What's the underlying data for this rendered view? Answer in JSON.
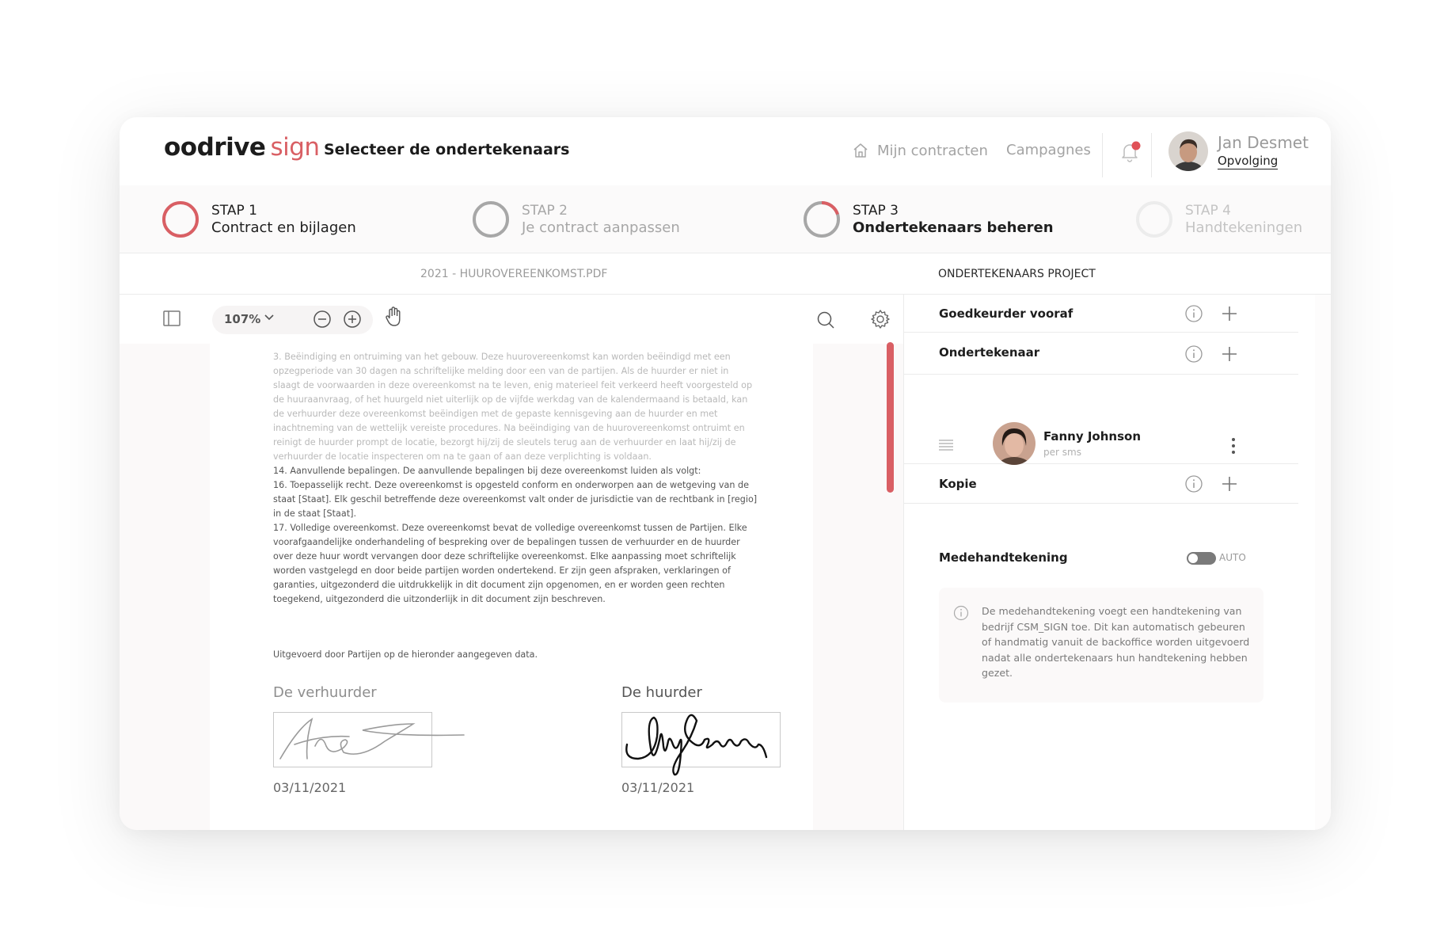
{
  "brand": {
    "name": "oodrive",
    "product": "sign",
    "accent": "#d95f64"
  },
  "header": {
    "page_title": "Selecteer de ondertekenaars",
    "nav": {
      "contracts": "Mijn contracten",
      "campaigns": "Campagnes"
    },
    "user": {
      "name": "Jan Desmet",
      "link": "Opvolging"
    },
    "icons": {
      "home": "home-icon",
      "bell": "bell-icon",
      "notification_dot": "#e05157"
    }
  },
  "steps": [
    {
      "num": "STAP 1",
      "label": "Contract en bijlagen",
      "progress": 1.0
    },
    {
      "num": "STAP 2",
      "label": "Je contract aanpassen",
      "progress": 0.0
    },
    {
      "num": "STAP 3",
      "label": "Ondertekenaars beheren",
      "progress": 0.2
    },
    {
      "num": "STAP 4",
      "label": "Handtekeningen",
      "progress": 0.0
    }
  ],
  "document": {
    "filename": "2021 - HUUROVEREENKOMST.PDF",
    "zoom": "107%",
    "paragraphs": [
      "3. Beëindiging en ontruiming van het gebouw.  Deze huurovereenkomst kan worden beëindigd met een opzegperiode van 30 dagen na schriftelijke melding door een van de partijen.  Als de huurder er niet in slaagt de voorwaarden in deze overeenkomst na te leven, enig materieel feit verkeerd heeft voorgesteld op de huuraanvraag, of het huurgeld niet uiterlijk op de vijfde werkdag van de kalendermaand is betaald, kan de verhuurder deze overeenkomst beëindigen met de gepaste kennisgeving aan de huurder en met inachtneming van de wettelijk vereiste procedures.  Na beëindiging van de huurovereenkomst ontruimt en reinigt de huurder prompt de locatie, bezorgt hij/zij de sleutels terug aan de verhuurder en laat hij/zij de verhuurder de locatie inspecteren om na te gaan of aan deze verplichting is voldaan.",
      "14. Aanvullende bepalingen.  De aanvullende bepalingen bij deze overeenkomst luiden als volgt:",
      "16. Toepasselijk recht.  Deze overeenkomst is opgesteld conform en onderworpen aan de wetgeving van de staat [Staat]. Elk geschil betreffende deze overeenkomst valt onder de jurisdictie van de rechtbank in [regio] in de staat [Staat].",
      "17. Volledige overeenkomst.  Deze overeenkomst bevat de volledige overeenkomst tussen de Partijen.  Elke voorafgaandelijke onderhandeling of bespreking over de bepalingen tussen de verhuurder en de huurder over deze huur wordt vervangen door deze schriftelijke overeenkomst. Elke aanpassing moet schriftelijk worden vastgelegd en door beide partijen worden ondertekend. Er zijn geen afspraken, verklaringen of garanties, uitgezonderd die uitdrukkelijk in dit document zijn opgenomen, en er worden geen rechten toegekend, uitgezonderd die uitzonderlijk in dit document zijn beschreven."
    ],
    "executed": "Uitgevoerd door Partijen op de hieronder aangegeven data.",
    "landlord": {
      "label": "De verhuurder",
      "date": "03/11/2021"
    },
    "tenant": {
      "label": "De huurder",
      "date": "03/11/2021"
    }
  },
  "panel": {
    "header": "ONDERTEKENAARS PROJECT",
    "approver": "Goedkeurder vooraf",
    "signer_section": "Ondertekenaar",
    "signer": {
      "name": "Fanny Johnson",
      "method": "per sms"
    },
    "copy": "Kopie",
    "cosign": {
      "title": "Medehandtekening",
      "toggle": "AUTO",
      "enabled": true
    },
    "info": "De medehandtekening voegt een handtekening van bedrijf CSM_SIGN toe. Dit kan automatisch gebeuren of handmatig vanuit de backoffice worden uitgevoerd nadat alle ondertekenaars hun handtekening hebben gezet."
  }
}
